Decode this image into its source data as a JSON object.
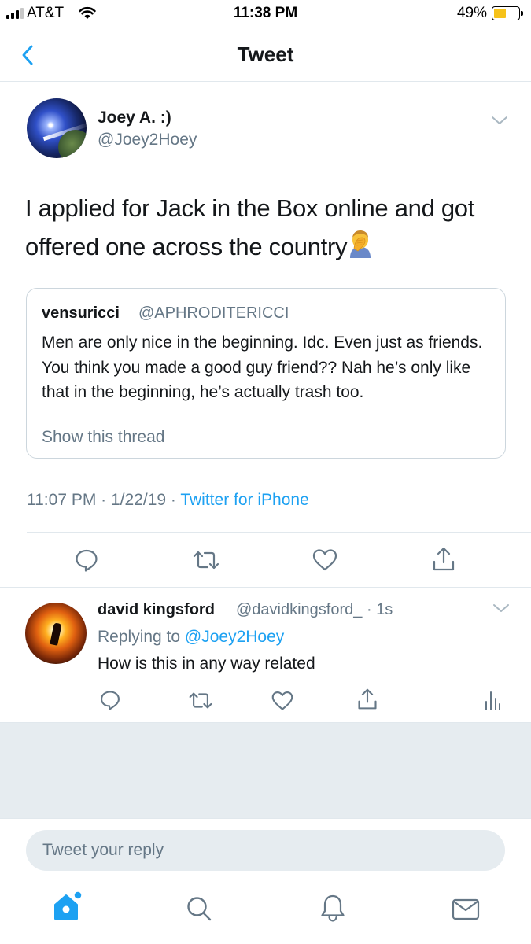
{
  "status_bar": {
    "carrier": "AT&T",
    "time": "11:38 PM",
    "battery": "49%",
    "battery_level": 0.49
  },
  "nav": {
    "title": "Tweet",
    "back_icon": "chevron-left-icon"
  },
  "tweet": {
    "name": "Joey A. :)",
    "handle": "@Joey2Hoey",
    "text": "I applied for Jack in the Box online and got offered one across the country",
    "emoji": "person-facepalming",
    "timestamp": "11:07 PM · 1/22/19 · ",
    "source": "Twitter for iPhone",
    "quote": {
      "name": "vensuricci",
      "handle": "@APHRODITERICCI",
      "text": "Men are only nice in the beginning. Idc. Even just as friends. You think you made a good guy friend?? Nah he’s only like that in the beginning, he’s actually trash too.",
      "show_thread": "Show this thread"
    },
    "actions": [
      "reply-icon",
      "retweet-icon",
      "like-icon",
      "share-icon"
    ]
  },
  "reply": {
    "name": "david kingsford",
    "handle": "@davidkingsford_ · 1s",
    "replying_prefix": "Replying to ",
    "replying_to": "@Joey2Hoey",
    "text": "How is this in any way related",
    "actions": [
      "reply-icon",
      "retweet-icon",
      "like-icon",
      "share-icon",
      "analytics-icon"
    ]
  },
  "composer": {
    "placeholder": "Tweet your reply"
  },
  "tabbar": {
    "items": [
      "home-icon",
      "search-icon",
      "notifications-icon",
      "messages-icon"
    ]
  },
  "colors": {
    "accent": "#1da1f2",
    "secondary_text": "#657786",
    "divider": "#e1e8ed",
    "background_gray": "#e6ecf0"
  }
}
